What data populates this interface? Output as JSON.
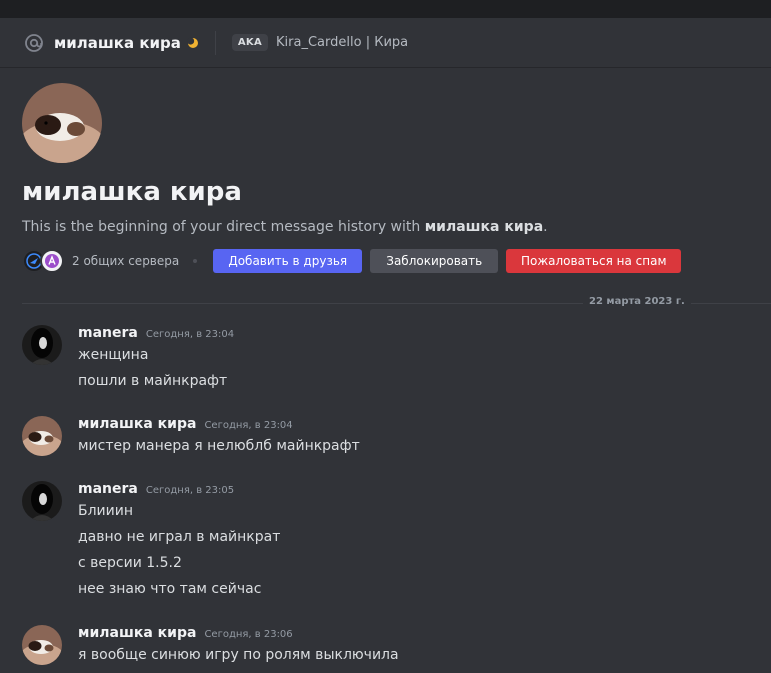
{
  "header": {
    "name": "милашка кира",
    "aka_badge": "AKA",
    "aka_names": "Kira_Cardello | Кира"
  },
  "intro": {
    "name": "милашка кира",
    "text_prefix": "This is the beginning of your direct message history with ",
    "text_name": "милашка кира",
    "text_suffix": ".",
    "mutual_servers": "2 общих сервера",
    "add_friend_label": "Добавить в друзья",
    "block_label": "Заблокировать",
    "spam_label": "Пожаловаться на спам"
  },
  "date_divider": "22 марта 2023 г.",
  "messages": [
    {
      "author": "manera",
      "time": "Сегодня, в 23:04",
      "lines": [
        "женщина",
        "пошли в майнкрафт"
      ]
    },
    {
      "author": "милашка кира",
      "time": "Сегодня, в 23:04",
      "lines": [
        "мистер манера я нелюблб майнкрафт"
      ]
    },
    {
      "author": "manera",
      "time": "Сегодня, в 23:05",
      "lines": [
        "Блииин",
        "давно не играл в майнкрат",
        "с версии 1.5.2",
        "нее знаю что там сейчас"
      ]
    },
    {
      "author": "милашка кира",
      "time": "Сегодня, в 23:06",
      "lines": [
        "я вообще синюю игру по ролям выключила"
      ]
    }
  ],
  "colors": {
    "background": "#313338",
    "blurple": "#5865f2",
    "danger": "#da373c",
    "secondary": "#4e5058",
    "moon": "#f0b232"
  }
}
